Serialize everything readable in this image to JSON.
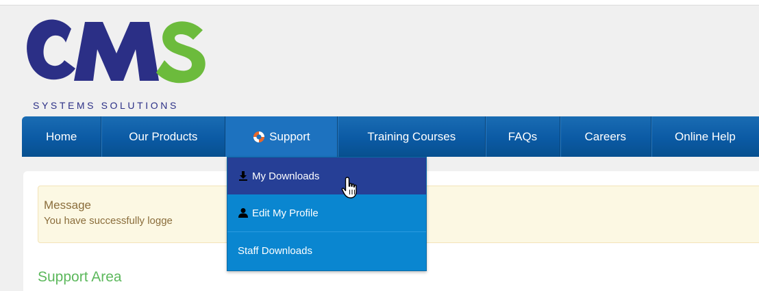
{
  "brand": {
    "logo_text": "CMS",
    "tagline": "SYSTEMS SOLUTIONS",
    "colors": {
      "blue": "#2b2f86",
      "green": "#6cbb3c"
    }
  },
  "nav": {
    "items": [
      {
        "label": "Home"
      },
      {
        "label": "Our Products"
      },
      {
        "label": "Support",
        "icon": "lifebuoy-icon",
        "active": true
      },
      {
        "label": "Training Courses"
      },
      {
        "label": "FAQs"
      },
      {
        "label": "Careers"
      },
      {
        "label": "Online Help"
      }
    ]
  },
  "dropdown": {
    "items": [
      {
        "label": "My Downloads",
        "icon": "download-icon",
        "hovered": true
      },
      {
        "label": "Edit My Profile",
        "icon": "user-icon"
      },
      {
        "label": "Staff Downloads"
      }
    ]
  },
  "alert": {
    "title": "Message",
    "text": "You have successfully logge"
  },
  "content": {
    "section_title": "Support Area"
  },
  "cursor": "hand-pointer-icon"
}
